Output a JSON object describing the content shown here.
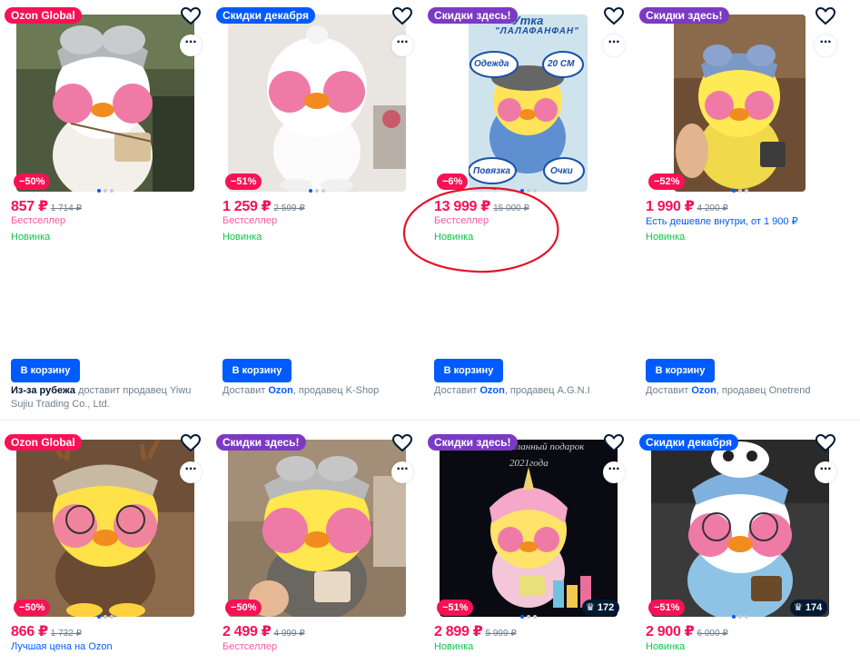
{
  "colors": {
    "accent": "#005bff",
    "price": "#f91155",
    "new": "#10c44c",
    "badge_global": "#f91155",
    "badge_december": "#005bff",
    "badge_here": "#7c3ac4",
    "annotation": "#e8102a"
  },
  "cart_label": "В корзину",
  "products": [
    {
      "badge": "Ozon Global",
      "discount": "−50%",
      "price": "857 ₽",
      "old_price": "1 714 ₽",
      "line1": "Бестселлер",
      "line2": "Новинка",
      "seller_prefix": "Из-за рубежа",
      "seller_text": "доставит продавец Yiwu Sujiu Trading Co., Ltd."
    },
    {
      "badge": "Скидки декабря",
      "discount": "−51%",
      "price": "1 259 ₽",
      "old_price": "2 599 ₽",
      "line1": "Бестселлер",
      "line2": "Новинка",
      "seller_prefix": "Доставит",
      "seller_brand": "Ozon",
      "seller_text": ", продавец K-Shop"
    },
    {
      "badge": "Скидки здесь!",
      "discount": "−6%",
      "price": "13 999 ₽",
      "old_price": "15 000 ₽",
      "line1": "Бестселлер",
      "line2": "Новинка",
      "seller_prefix": "Доставит",
      "seller_brand": "Ozon",
      "seller_text": ", продавец A.G.N.I",
      "image_text": {
        "title1": "Утка",
        "title2": "\"ЛАЛАФАНФАН\"",
        "tag1": "Одежда",
        "tag2": "20 СМ",
        "tag3": "Повязка",
        "tag4": "Очки"
      }
    },
    {
      "badge": "Скидки здесь!",
      "discount": "−52%",
      "price": "1 990 ₽",
      "old_price": "4 200 ₽",
      "line1": "Есть дешевле внутри, от 1 900 ₽",
      "line2": "Новинка",
      "seller_prefix": "Доставит",
      "seller_brand": "Ozon",
      "seller_text": ", продавец Onetrend"
    },
    {
      "badge": "Ozon Global",
      "discount": "−50%",
      "price": "866 ₽",
      "old_price": "1 732 ₽",
      "line1": "Лучшая цена на Ozon"
    },
    {
      "badge": "Скидки здесь!",
      "discount": "−50%",
      "price": "2 499 ₽",
      "old_price": "4 999 ₽",
      "line1": "Бестселлер"
    },
    {
      "badge": "Скидки здесь!",
      "discount": "−51%",
      "price": "2 899 ₽",
      "old_price": "5 999 ₽",
      "line1": "Новинка",
      "crown_count": "172",
      "image_text": {
        "title1": "Самый желанный подарок",
        "title2": "2021года"
      }
    },
    {
      "badge": "Скидки декабря",
      "discount": "−51%",
      "price": "2 900 ₽",
      "old_price": "6 000 ₽",
      "line1": "Новинка",
      "crown_count": "174"
    }
  ]
}
